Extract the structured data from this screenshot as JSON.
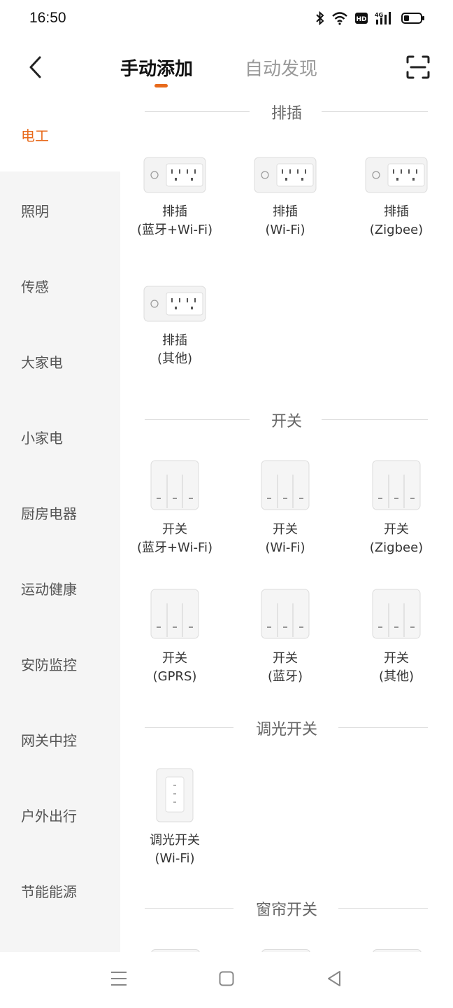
{
  "status": {
    "time": "16:50",
    "icons": [
      "bluetooth-icon",
      "wifi-icon",
      "hd-icon",
      "signal-4g-icon",
      "battery-icon"
    ]
  },
  "header": {
    "back_icon": "chevron-left-icon",
    "tabs": [
      {
        "label": "手动添加",
        "active": true
      },
      {
        "label": "自动发现",
        "active": false
      }
    ],
    "scan_icon": "scan-icon",
    "accent": "#e86a1c"
  },
  "sidebar": {
    "items": [
      {
        "label": "电工",
        "active": true
      },
      {
        "label": "照明"
      },
      {
        "label": "传感"
      },
      {
        "label": "大家电"
      },
      {
        "label": "小家电"
      },
      {
        "label": "厨房电器"
      },
      {
        "label": "运动健康"
      },
      {
        "label": "安防监控"
      },
      {
        "label": "网关中控"
      },
      {
        "label": "户外出行"
      },
      {
        "label": "节能能源"
      }
    ]
  },
  "sections": [
    {
      "title": "排插",
      "devices": [
        {
          "name": "排插",
          "sub": "(蓝牙+Wi-Fi)",
          "icon": "power-strip-icon"
        },
        {
          "name": "排插",
          "sub": "(Wi-Fi)",
          "icon": "power-strip-icon"
        },
        {
          "name": "排插",
          "sub": "(Zigbee)",
          "icon": "power-strip-icon"
        },
        {
          "name": "排插",
          "sub": "(其他)",
          "icon": "power-strip-icon"
        }
      ]
    },
    {
      "title": "开关",
      "devices": [
        {
          "name": "开关",
          "sub": "(蓝牙+Wi-Fi)",
          "icon": "wall-switch-icon"
        },
        {
          "name": "开关",
          "sub": "(Wi-Fi)",
          "icon": "wall-switch-icon"
        },
        {
          "name": "开关",
          "sub": "(Zigbee)",
          "icon": "wall-switch-icon"
        },
        {
          "name": "开关",
          "sub": "(GPRS)",
          "icon": "wall-switch-icon"
        },
        {
          "name": "开关",
          "sub": "(蓝牙)",
          "icon": "wall-switch-icon"
        },
        {
          "name": "开关",
          "sub": "(其他)",
          "icon": "wall-switch-icon"
        }
      ]
    },
    {
      "title": "调光开关",
      "devices": [
        {
          "name": "调光开关",
          "sub": "(Wi-Fi)",
          "icon": "dimmer-switch-icon"
        }
      ]
    },
    {
      "title": "窗帘开关",
      "devices": []
    }
  ],
  "nav": {
    "icons": [
      "menu-icon",
      "home-icon",
      "back-triangle-icon"
    ]
  }
}
